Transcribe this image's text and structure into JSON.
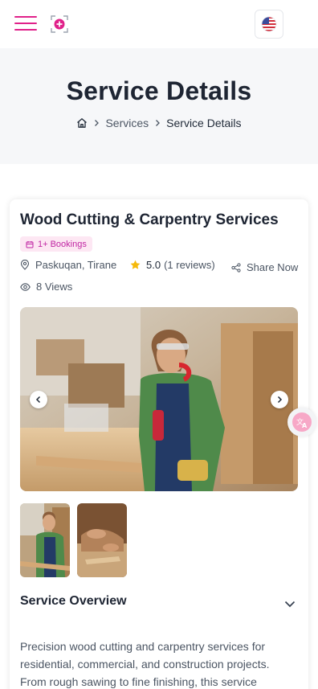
{
  "header": {
    "menu_icon": "hamburger-icon",
    "logo_icon": "app-logo-icon",
    "language_icon": "us-flag-icon"
  },
  "hero": {
    "title": "Service Details",
    "breadcrumb": {
      "home_icon": "home-icon",
      "items": [
        "Services",
        "Service Details"
      ]
    }
  },
  "service": {
    "title": "Wood Cutting & Carpentry Services",
    "bookings_badge": "1+ Bookings",
    "location": "Paskuqan, Tirane",
    "rating": "5.0",
    "reviews": "(1 reviews)",
    "share_label": "Share Now",
    "views": "8 Views",
    "accent_color": "#e0218a"
  },
  "gallery": {
    "prev_icon": "chevron-left-icon",
    "next_icon": "chevron-right-icon",
    "thumbnail_count": 2
  },
  "overview": {
    "title": "Service Overview",
    "text": "Precision wood cutting and carpentry services for residential, commercial, and construction projects. From rough sawing to fine finishing, this service"
  },
  "floating": {
    "translate_icon": "translate-icon"
  }
}
